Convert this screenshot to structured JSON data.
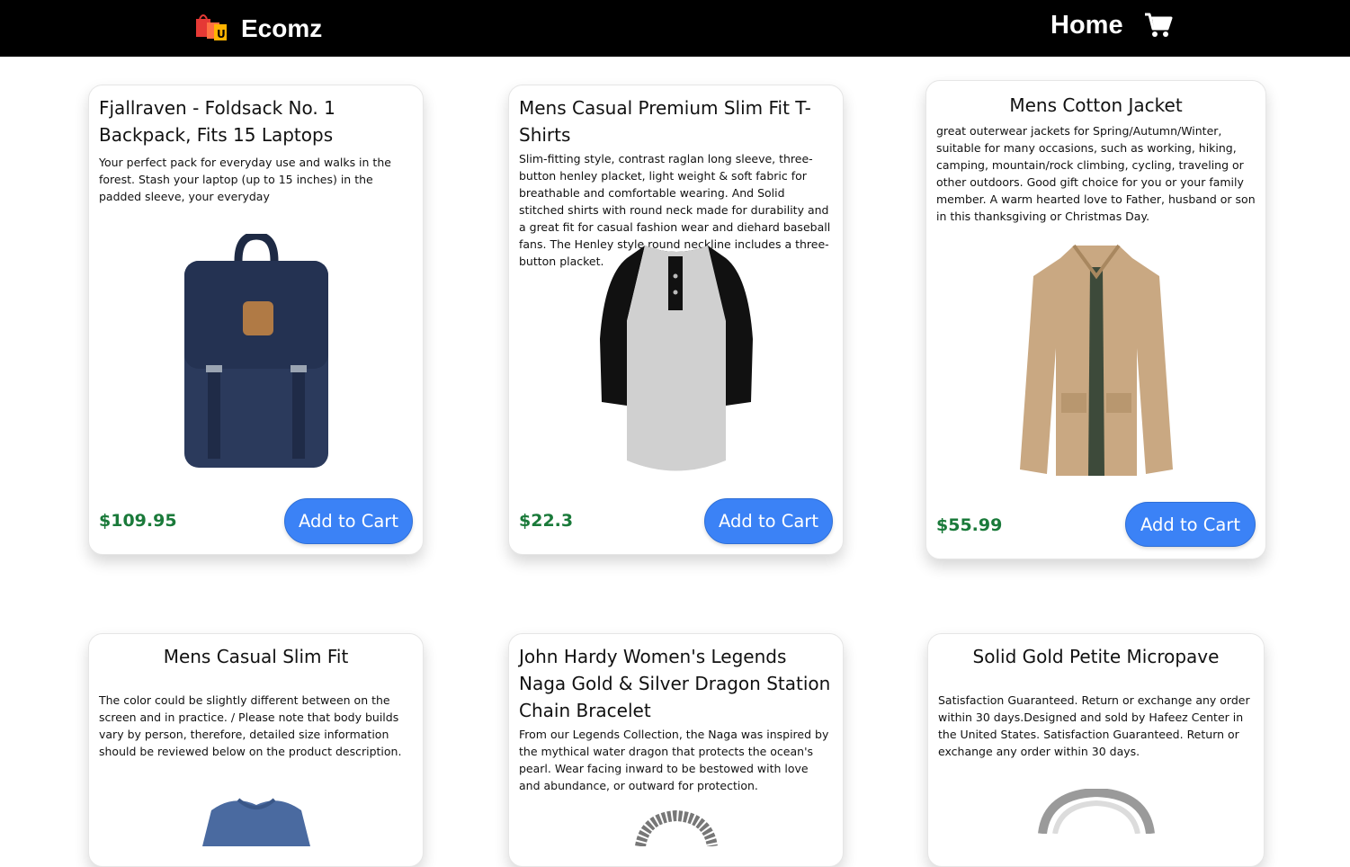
{
  "header": {
    "brand": "Ecomz",
    "nav_home": "Home",
    "logo_icon": "shopping-bags-logo",
    "cart_icon": "cart-icon"
  },
  "colors": {
    "topbar": "#000000",
    "price": "#1a7a3a",
    "button": "#3b82f6"
  },
  "products": [
    {
      "title": "Fjallraven - Foldsack No. 1 Backpack, Fits 15 Laptops",
      "description": "Your perfect pack for everyday use and walks in the forest. Stash your laptop (up to 15 inches) in the padded sleeve, your everyday",
      "price": "$109.95",
      "button": "Add to Cart",
      "image_icon": "backpack-image"
    },
    {
      "title": "Mens Casual Premium Slim Fit T-Shirts",
      "description": "Slim-fitting style, contrast raglan long sleeve, three-button henley placket, light weight & soft fabric for breathable and comfortable wearing. And Solid stitched shirts with round neck made for durability and a great fit for casual fashion wear and diehard baseball fans. The Henley style round neckline includes a three-button placket.",
      "price": "$22.3",
      "button": "Add to Cart",
      "image_icon": "henley-tshirt-image"
    },
    {
      "title": "Mens Cotton Jacket",
      "description": "great outerwear jackets for Spring/Autumn/Winter, suitable for many occasions, such as working, hiking, camping, mountain/rock climbing, cycling, traveling or other outdoors. Good gift choice for you or your family member. A warm hearted love to Father, husband or son in this thanksgiving or Christmas Day.",
      "price": "$55.99",
      "button": "Add to Cart",
      "image_icon": "jacket-image"
    },
    {
      "title": "Mens Casual Slim Fit",
      "description": "The color could be slightly different between on the screen and in practice. / Please note that body builds vary by person, therefore, detailed size information should be reviewed below on the product description.",
      "image_icon": "tshirt-image"
    },
    {
      "title": "John Hardy Women's Legends Naga Gold & Silver Dragon Station Chain Bracelet",
      "description": "From our Legends Collection, the Naga was inspired by the mythical water dragon that protects the ocean's pearl. Wear facing inward to be bestowed with love and abundance, or outward for protection.",
      "image_icon": "bracelet-image"
    },
    {
      "title": "Solid Gold Petite Micropave",
      "description": "Satisfaction Guaranteed. Return or exchange any order within 30 days.Designed and sold by Hafeez Center in the United States. Satisfaction Guaranteed. Return or exchange any order within 30 days.",
      "image_icon": "ring-image"
    }
  ]
}
